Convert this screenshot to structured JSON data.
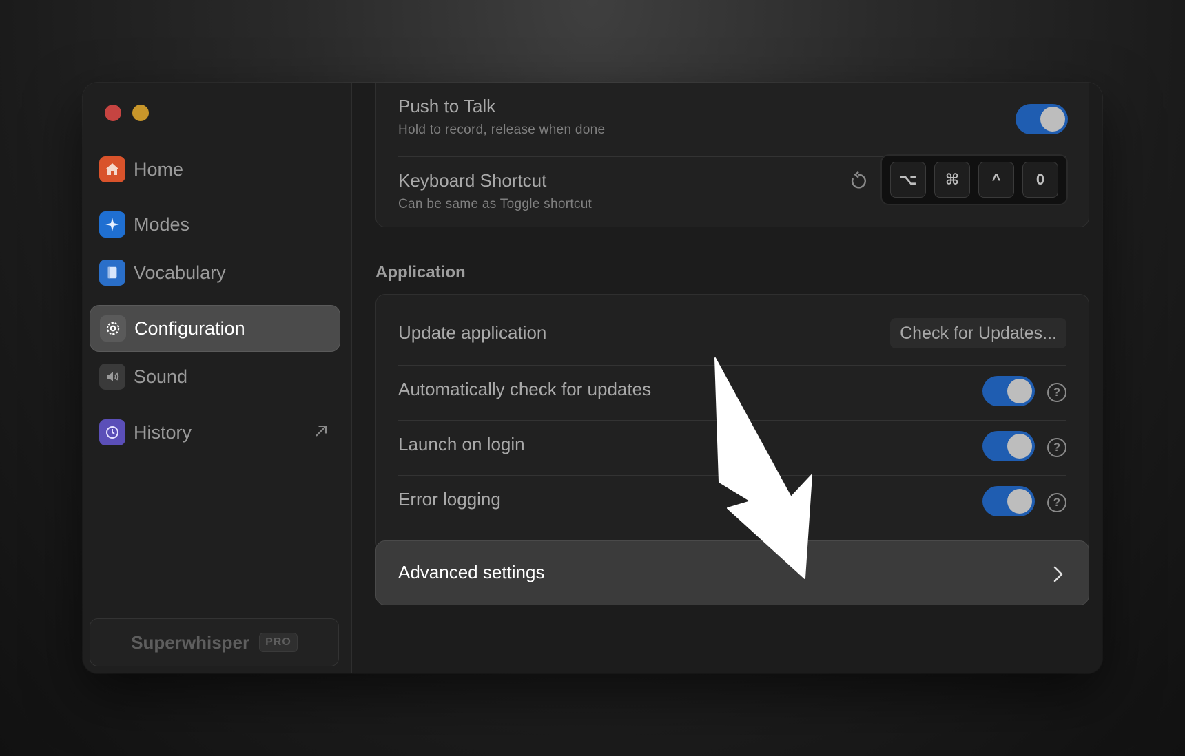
{
  "sidebar": {
    "items": [
      {
        "label": "Home",
        "icon": "house-icon",
        "color": "#d9532b"
      },
      {
        "label": "Modes",
        "icon": "sparkle-icon",
        "color": "#1f6fd1"
      },
      {
        "label": "Vocabulary",
        "icon": "book-icon",
        "color": "#2a6fc9"
      },
      {
        "label": "Configuration",
        "icon": "gear-icon",
        "color": "#5a5a5a",
        "active": true
      },
      {
        "label": "Sound",
        "icon": "speaker-icon",
        "color": "#3a3a3a"
      },
      {
        "label": "History",
        "icon": "history-icon",
        "color": "#5b4fb8"
      }
    ],
    "brand": {
      "name": "Superwhisper",
      "badge": "PRO"
    }
  },
  "recording": {
    "push_to_talk": {
      "title": "Push to Talk",
      "subtitle": "Hold to record, release when done",
      "enabled": true
    },
    "keyboard_shortcut": {
      "title": "Keyboard Shortcut",
      "subtitle": "Can be same as Toggle shortcut",
      "keys": [
        "⌥",
        "⌘",
        "^",
        "0"
      ]
    }
  },
  "application": {
    "section_title": "Application",
    "update": {
      "title": "Update application",
      "button": "Check for Updates..."
    },
    "auto_check": {
      "title": "Automatically check for updates",
      "enabled": true
    },
    "launch_on_login": {
      "title": "Launch on login",
      "enabled": true
    },
    "error_logging": {
      "title": "Error logging",
      "enabled": true
    }
  },
  "advanced": {
    "label": "Advanced settings"
  },
  "colors": {
    "toggle_on": "#1f5db1",
    "accent_red": "#c64441",
    "accent_yellow": "#c8962a"
  }
}
